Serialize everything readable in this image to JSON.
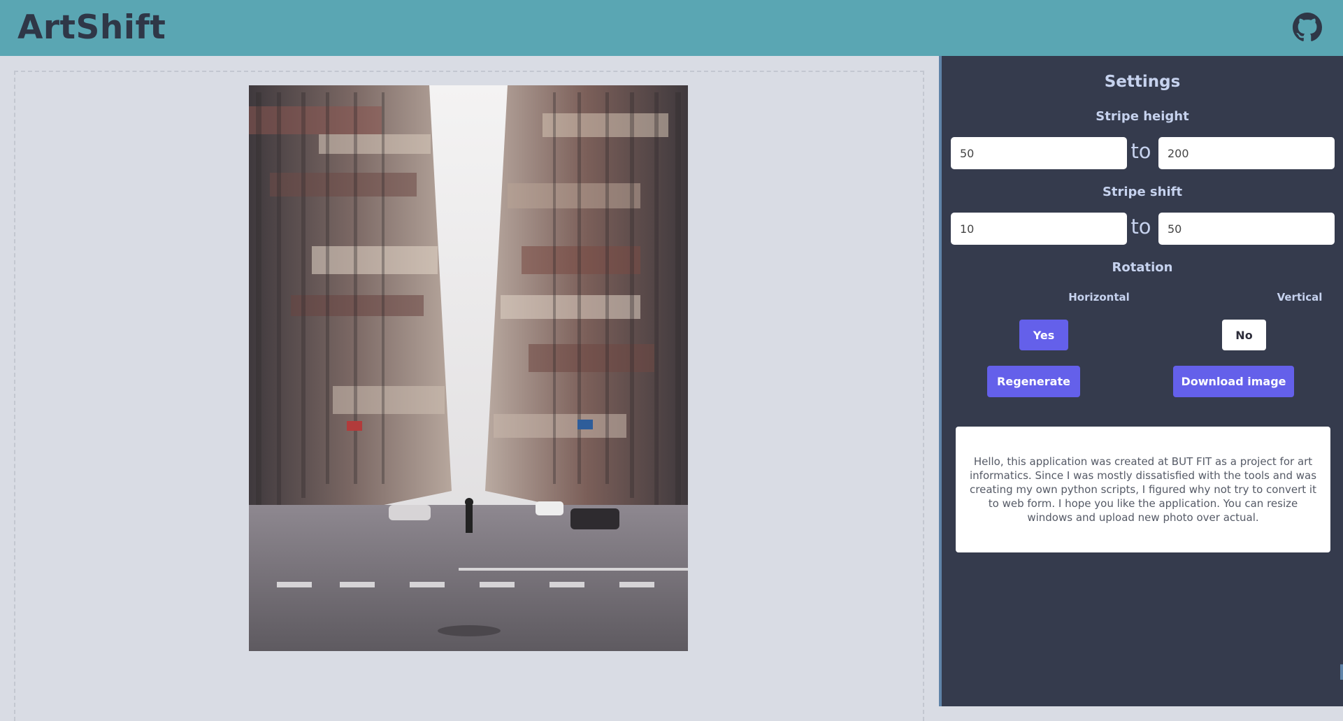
{
  "app": {
    "title": "ArtShift"
  },
  "header": {
    "github_icon": "github-icon"
  },
  "settings": {
    "title": "Settings",
    "stripe_height": {
      "label": "Stripe height",
      "from": "50",
      "separator": "to",
      "to": "200"
    },
    "stripe_shift": {
      "label": "Stripe shift",
      "from": "10",
      "separator": "to",
      "to": "50"
    },
    "rotation": {
      "label": "Rotation",
      "horizontal_label": "Horizontal",
      "horizontal_value": "Yes",
      "vertical_label": "Vertical",
      "vertical_value": "No"
    },
    "regenerate_label": "Regenerate",
    "download_label": "Download image"
  },
  "info_text": "Hello, this application was created at BUT FIT as a project for art informatics. Since I was mostly dissatisfied with the tools and was creating my own python scripts, I figured why not try to convert it to web form. I hope you like the application. You can resize windows and upload new photo over actual.",
  "colors": {
    "header": "#5aa6b3",
    "panel": "#353b4d",
    "accent": "#6460ea",
    "canvas_bg": "#d9dce4"
  }
}
